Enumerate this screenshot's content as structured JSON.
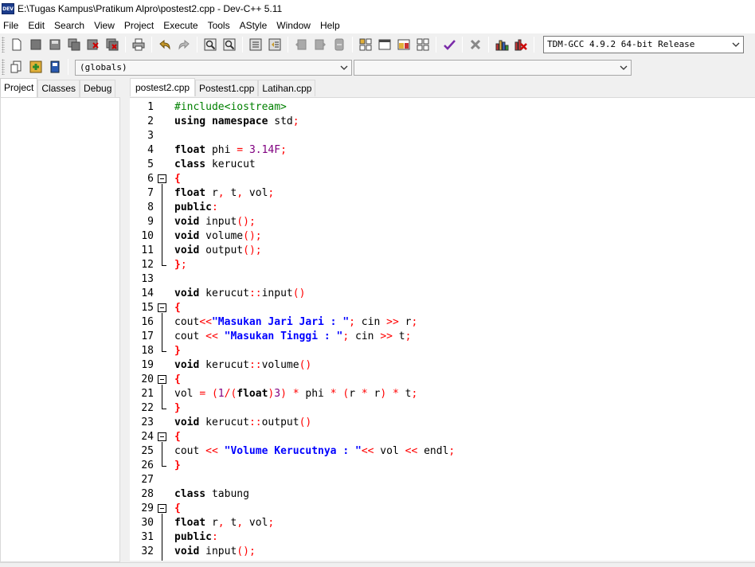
{
  "window": {
    "title": "E:\\Tugas Kampus\\Pratikum Alpro\\postest2.cpp - Dev-C++ 5.11",
    "icon_label": "DEV"
  },
  "menu": [
    "File",
    "Edit",
    "Search",
    "View",
    "Project",
    "Execute",
    "Tools",
    "AStyle",
    "Window",
    "Help"
  ],
  "toolbar": {
    "compiler": "TDM-GCC 4.9.2 64-bit Release",
    "scope": "(globals)",
    "member": ""
  },
  "left_tabs": [
    "Project",
    "Classes",
    "Debug"
  ],
  "editor_tabs": [
    "postest2.cpp",
    "Postest1.cpp",
    "Latihan.cpp"
  ],
  "code_lines": [
    {
      "n": "1",
      "t": "#include<iostream>"
    },
    {
      "n": "2",
      "t": "using namespace std;"
    },
    {
      "n": "3",
      "t": ""
    },
    {
      "n": "4",
      "t": "float phi = 3.14F;"
    },
    {
      "n": "5",
      "t": "class kerucut"
    },
    {
      "n": "6",
      "t": "{"
    },
    {
      "n": "7",
      "t": "float r, t, vol;"
    },
    {
      "n": "8",
      "t": "public:"
    },
    {
      "n": "9",
      "t": "void input();"
    },
    {
      "n": "10",
      "t": "void volume();"
    },
    {
      "n": "11",
      "t": "void output();"
    },
    {
      "n": "12",
      "t": "};"
    },
    {
      "n": "13",
      "t": ""
    },
    {
      "n": "14",
      "t": "void kerucut::input()"
    },
    {
      "n": "15",
      "t": "{"
    },
    {
      "n": "16",
      "t": "cout<<\"Masukan Jari Jari : \"; cin >> r;"
    },
    {
      "n": "17",
      "t": "cout << \"Masukan Tinggi : \"; cin >> t;"
    },
    {
      "n": "18",
      "t": "}"
    },
    {
      "n": "19",
      "t": "void kerucut::volume()"
    },
    {
      "n": "20",
      "t": "{"
    },
    {
      "n": "21",
      "t": "vol = (1/(float)3) * phi * (r * r) * t;"
    },
    {
      "n": "22",
      "t": "}"
    },
    {
      "n": "23",
      "t": "void kerucut::output()"
    },
    {
      "n": "24",
      "t": "{"
    },
    {
      "n": "25",
      "t": "cout << \"Volume Kerucutnya : \"<< vol << endl;"
    },
    {
      "n": "26",
      "t": "}"
    },
    {
      "n": "27",
      "t": ""
    },
    {
      "n": "28",
      "t": "class tabung"
    },
    {
      "n": "29",
      "t": "{"
    },
    {
      "n": "30",
      "t": "float r, t, vol;"
    },
    {
      "n": "31",
      "t": "public:"
    },
    {
      "n": "32",
      "t": "void input();"
    }
  ],
  "folds": [
    {
      "start": 6,
      "end": 12
    },
    {
      "start": 15,
      "end": 18
    },
    {
      "start": 20,
      "end": 22
    },
    {
      "start": 24,
      "end": 26
    },
    {
      "start": 29,
      "end": 33
    }
  ],
  "colors": {
    "keyword": "#000000",
    "preprocessor": "#008000",
    "number": "#800080",
    "string": "#0000ff",
    "symbol": "#ff0000"
  }
}
